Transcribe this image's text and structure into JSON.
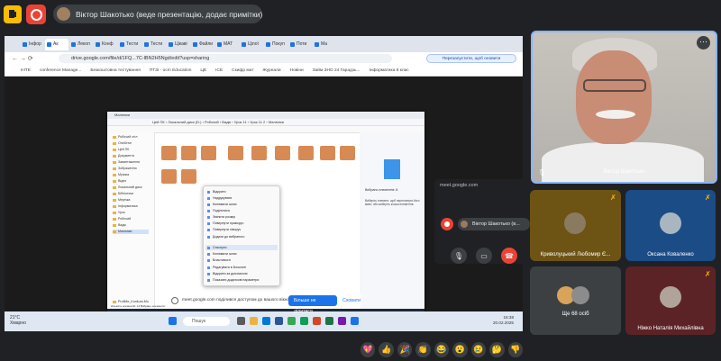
{
  "topbar": {
    "presenter_text": "Віктор Шакотько (веде презентацію, додає примітки)"
  },
  "browser": {
    "tabs": [
      "Інфор",
      "Ак",
      "Лекоп",
      "Конф",
      "Тести",
      "Тести",
      "Цікаві",
      "Файли",
      "МАТ",
      "Цілої",
      "Покуп",
      "Поти",
      "Ма"
    ],
    "address": "drive.google.com/file/d/1FQ...7C-lBN2H5Ngd/edit?usp=sharing",
    "address_button": "Перезапустити, щоб оновити",
    "bookmarks": [
      "ІНТЕ",
      "conference Manage...",
      "Безкоштовна тестування",
      "ПТЗІ - ocm Education",
      "ЦЕ",
      "ІСЕ",
      "Скифр мат",
      "Журнали",
      "Новіни",
      "Займ ЗНО 24 Гарадзь...",
      "Інформатика 6 клас"
    ]
  },
  "remote": {
    "title": "Малюнки",
    "path": "Цей ПК › Локальний диск (D:) › Робочий › Вадік › Урок 11 › Урок 11 2 › Малюнки",
    "sidebar": [
      "Робочий стіл",
      "OneDrive",
      "Цей ПК",
      "Документи",
      "Завантаження",
      "Зображення",
      "Музика",
      "Відео",
      "Локальний диск",
      "Бібліотеки",
      "Мережа",
      "Інформатика",
      "Урок",
      "Робочий",
      "Вадік",
      "Малюнки",
      "ProfiMe_Konkurs-Mor"
    ],
    "files": [
      "",
      "",
      "",
      "",
      "",
      "",
      "",
      "",
      "",
      "",
      "",
      "",
      "",
      ""
    ],
    "context_menu": [
      "Відкрити",
      "Надрукувати",
      "Копіювати шлях",
      "Поділитися",
      "Змінити розмір",
      "Повернути праворуч",
      "Повернути ліворуч",
      "Додати до вибраного",
      "Стиснути",
      "Копіювати шлях",
      "Властивості",
      "Редагувати в Блокноті",
      "Відкрити за допомогою",
      "Показати додаткові параметри"
    ],
    "preview_title": "Вибрано елементів: 8",
    "preview_text": "Виберіть елемент, щоб переглянути його вміст, або виберіть кілька елементів.",
    "status": "Кількість елементів: 14   Вибрано елементів: 8"
  },
  "banner": {
    "message": "meet.google.com поділився доступом до вашого вікна.",
    "share_label": "Більше не ділитися",
    "later_label": "Сховати"
  },
  "win_taskbar": {
    "weather_temp": "21°C",
    "weather_desc": "Хмарно",
    "search": "Пошук",
    "time": "15:38",
    "date": "20.02.2025"
  },
  "meet_popup": {
    "title": "meet.google.com",
    "presenter_chip": "Віктор Шакотько (в..."
  },
  "tiles": {
    "main_name": "Віктор Шакотько",
    "t1_name": "Криволуцький Любомир Є...",
    "t2_name": "Оксана Коваленко",
    "t3_name": "Ще 68 осіб",
    "t4_name": "Ніжко Наталія Михайлівна"
  },
  "reactions": [
    "💖",
    "👍",
    "🎉",
    "👏",
    "😂",
    "😮",
    "😢",
    "🤔",
    "👎"
  ]
}
